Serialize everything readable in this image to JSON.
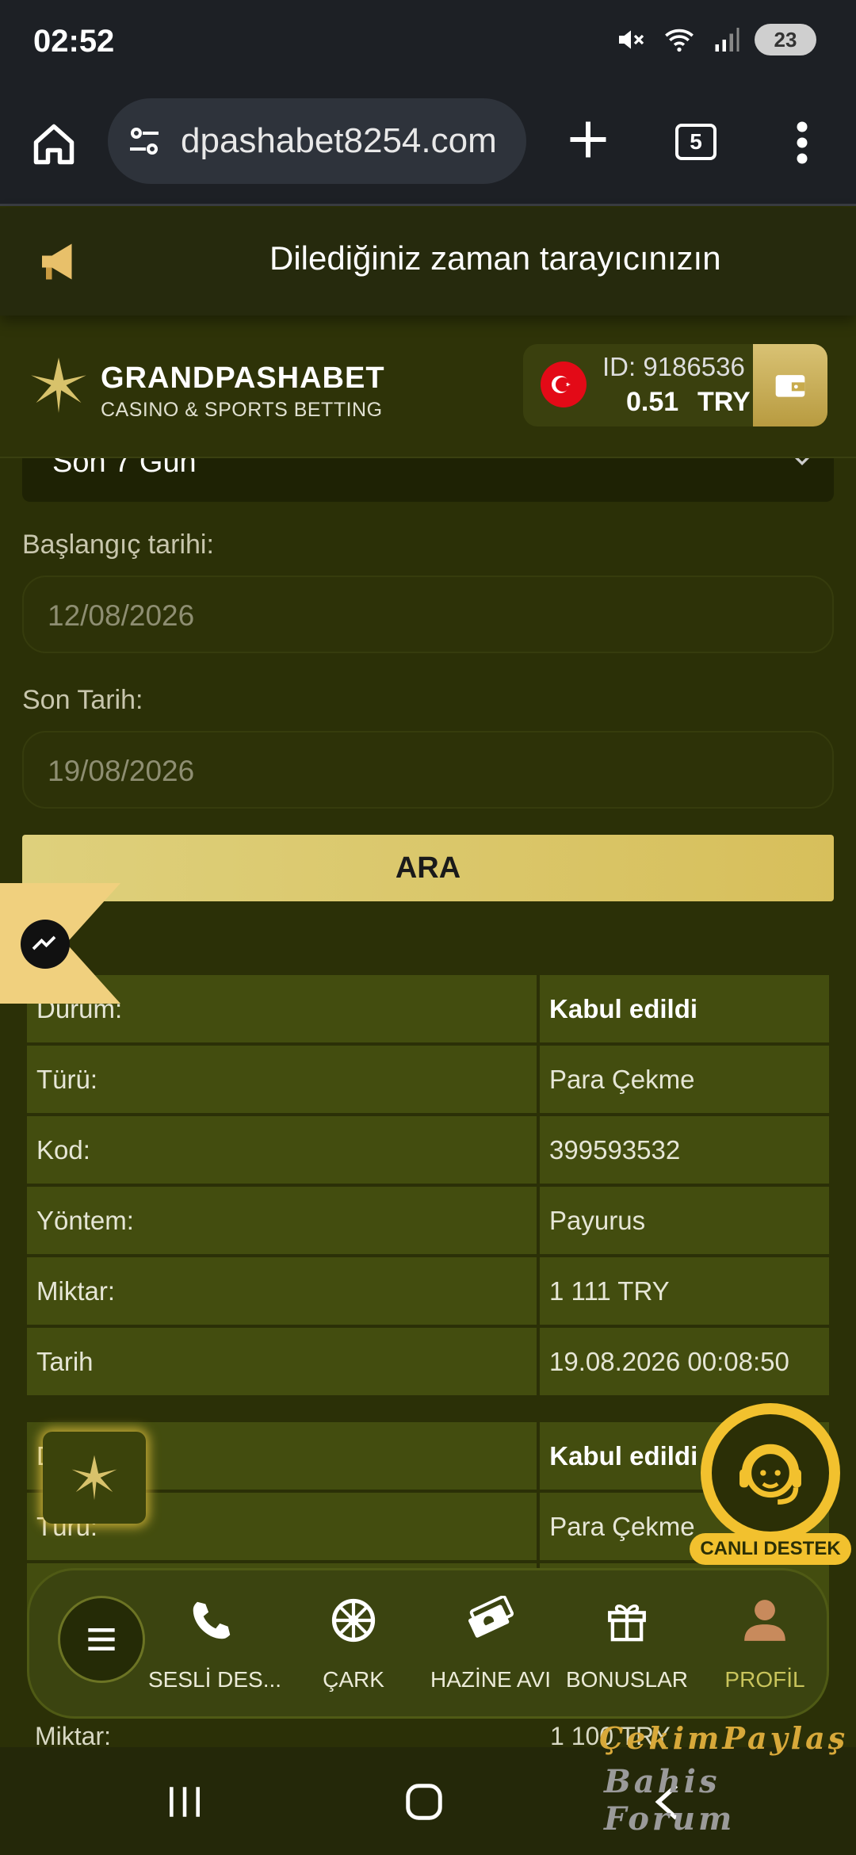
{
  "status_bar": {
    "time": "02:52",
    "battery": "23"
  },
  "browser": {
    "url": "dpashabet8254.com",
    "tab_count": "5"
  },
  "notice": {
    "text": "Dilediğiniz zaman tarayıcınızın"
  },
  "header": {
    "brand_name": "GRANDPASHABET",
    "brand_sub": "CASINO & SPORTS BETTING",
    "account_id": "ID: 9186536",
    "balance": "0.51",
    "currency": "TRY"
  },
  "filter": {
    "period": "Son 7 Gün",
    "start_label": "Başlangıç tarihi:",
    "start_value": "12/08/2026",
    "end_label": "Son Tarih:",
    "end_value": "19/08/2026",
    "search_button": "ARA"
  },
  "transactions": [
    {
      "status_label": "Durum:",
      "status": "Kabul edildi",
      "type_label": "Türü:",
      "type": "Para Çekme",
      "code_label": "Kod:",
      "code": "399593532",
      "method_label": "Yöntem:",
      "method": "Payurus",
      "amount_label": "Miktar:",
      "amount": "1 111 TRY",
      "date_label": "Tarih",
      "date": "19.08.2026 00:08:50"
    },
    {
      "status_label": "Durum:",
      "status": "Kabul edildi",
      "type_label": "Türü:",
      "type": "Para Çekme",
      "amount_label": "Miktar:",
      "amount": "1 100 TRY"
    }
  ],
  "live_support": {
    "label": "CANLI DESTEK"
  },
  "bottom_nav": [
    {
      "label": "SESLİ DES...",
      "icon": "phone-icon"
    },
    {
      "label": "ÇARK",
      "icon": "wheel-icon"
    },
    {
      "label": "HAZİNE AVI",
      "icon": "treasure-icon"
    },
    {
      "label": "BONUSLAR",
      "icon": "gift-icon"
    },
    {
      "label": "PROFİL",
      "icon": "user-icon",
      "active": true
    }
  ],
  "watermark": {
    "line1": "ÇekimPaylaş",
    "line2": "Bahis Forum"
  },
  "colors": {
    "accent_gold": "#d8c26b",
    "bg": "#2b3007",
    "row": "#434d0f"
  }
}
